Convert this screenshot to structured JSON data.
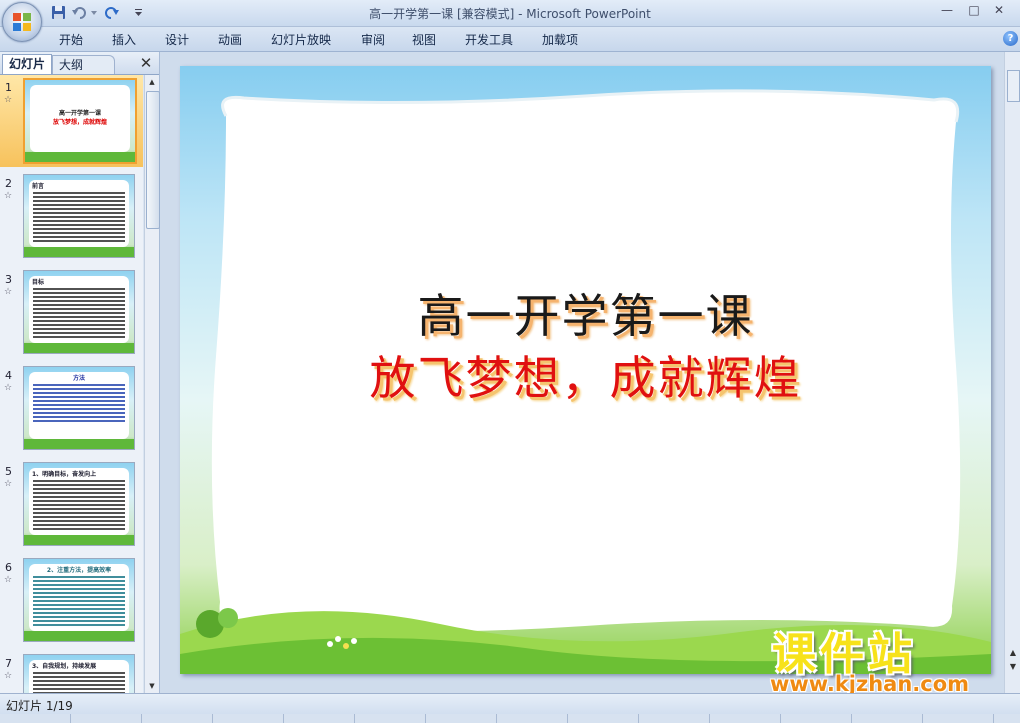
{
  "window": {
    "title": "高一开学第一课 [兼容模式] - Microsoft PowerPoint",
    "min_glyph": "—",
    "max_glyph": "□",
    "close_glyph": "✕"
  },
  "ribbon": {
    "tabs": [
      "开始",
      "插入",
      "设计",
      "动画",
      "幻灯片放映",
      "审阅",
      "视图",
      "开发工具",
      "加载项"
    ],
    "help_glyph": "?"
  },
  "left_pane": {
    "tab_slides": "幻灯片",
    "tab_outline": "大纲",
    "close_glyph": "✕",
    "thumbnails": [
      {
        "num": "1",
        "line1": "高一开学第一课",
        "line2": "放飞梦想，成就辉煌"
      },
      {
        "num": "2",
        "heading": "前言"
      },
      {
        "num": "3",
        "heading": "目标"
      },
      {
        "num": "4",
        "heading": "方法"
      },
      {
        "num": "5",
        "heading": "1、明确目标，奋发向上"
      },
      {
        "num": "6",
        "heading": "2、注重方法，提高效率"
      },
      {
        "num": "7",
        "heading": "3、自我规划，持续发展"
      }
    ],
    "star_glyph": "☆"
  },
  "slide": {
    "title": "高一开学第一课",
    "subtitle": "放飞梦想，成就辉煌"
  },
  "watermark": {
    "text": "课件站",
    "url": "www.kjzhan.com"
  },
  "status": {
    "slide_indicator": "幻灯片 1/19"
  },
  "colors": {
    "title_color": "#1a1a1a",
    "subtitle_color": "#e01010",
    "selection_color": "#f7c25c"
  }
}
